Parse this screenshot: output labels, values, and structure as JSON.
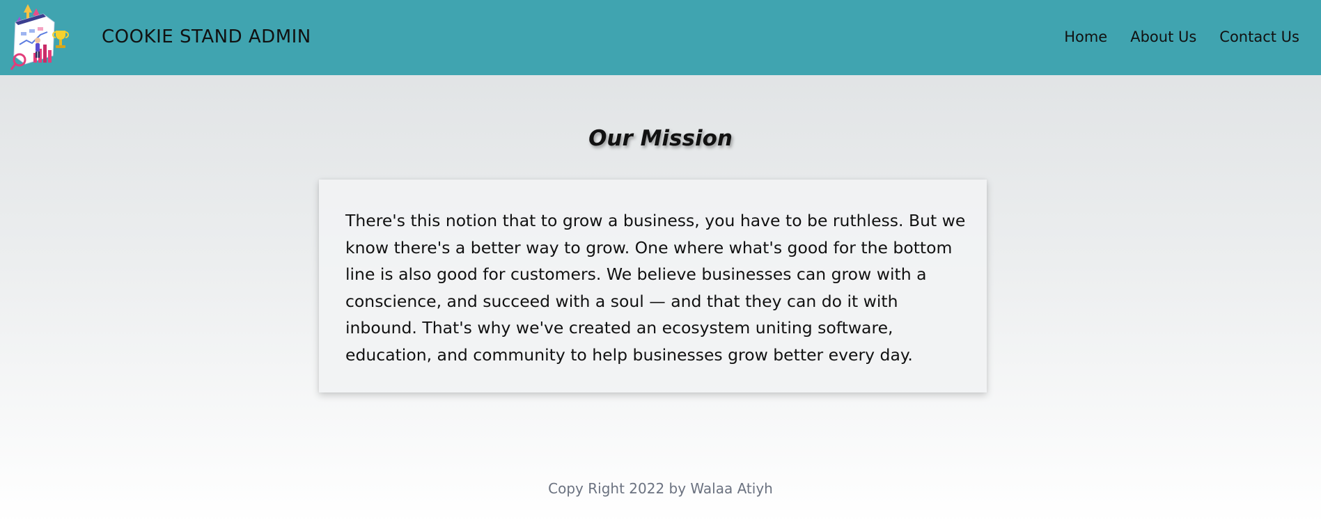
{
  "header": {
    "brand": "COOKIE STAND ADMIN",
    "background_color": "#40a4b0",
    "logo_icon": "business-growth-illustration-icon",
    "nav": {
      "home": "Home",
      "about": "About Us",
      "contact": "Contact Us"
    }
  },
  "main": {
    "title": "Our Mission",
    "body": "There's this notion that to grow a business, you have to be ruthless. But we know there's a better way to grow. One where what's good for the bottom line is also good for customers. We believe businesses can grow with a conscience, and succeed with a soul — and that they can do it with inbound. That's why we've created an ecosystem uniting software, education, and community to help businesses grow better every day."
  },
  "footer": {
    "text": "Copy Right 2022 by Walaa Atiyh"
  }
}
